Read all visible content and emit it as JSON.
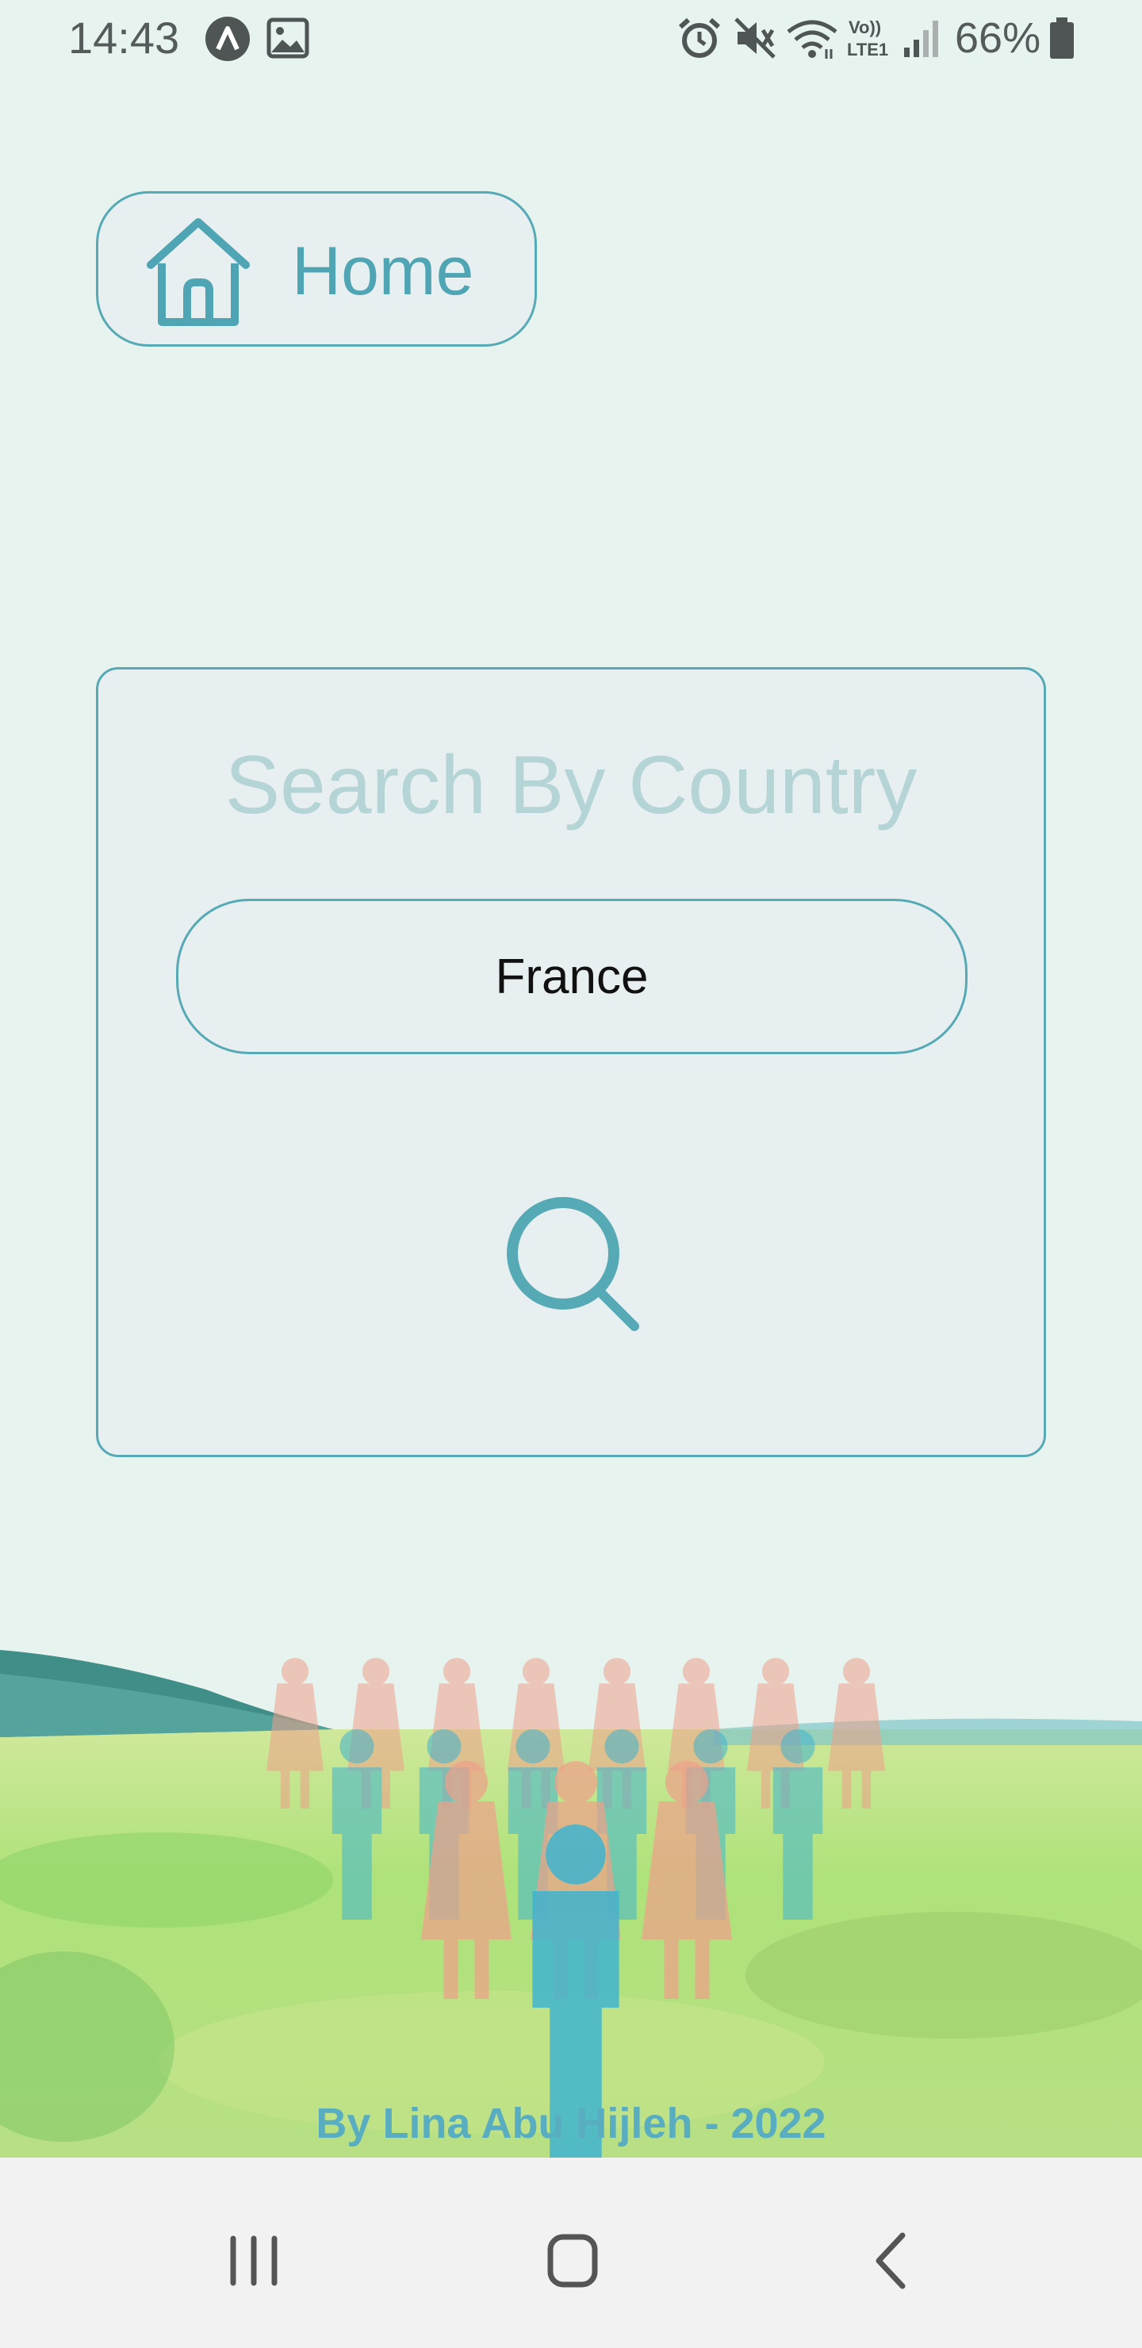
{
  "status_bar": {
    "time": "14:43",
    "battery_percent": "66%",
    "icons": [
      "app-notification-icon",
      "image-notification-icon",
      "alarm-icon",
      "mute-icon",
      "wifi-icon",
      "volte-icon",
      "signal-icon",
      "battery-icon"
    ],
    "volte_line1": "Vo))",
    "volte_line2": "LTE1"
  },
  "home_button": {
    "label": "Home",
    "icon": "home-icon"
  },
  "search_card": {
    "title": "Search By Country",
    "input_value": "France",
    "button_icon": "search-icon"
  },
  "footer": {
    "credit": "By Lina Abu Hijleh - 2022"
  },
  "nav_bar": {
    "buttons": [
      "recent-apps-icon",
      "home-nav-icon",
      "back-icon"
    ]
  },
  "colors": {
    "background": "#e6f3ef",
    "accent": "#56aab5",
    "title_muted": "#b5d4d6",
    "figure_blue": "#3fb4cf",
    "figure_pink": "#f0a08a"
  }
}
